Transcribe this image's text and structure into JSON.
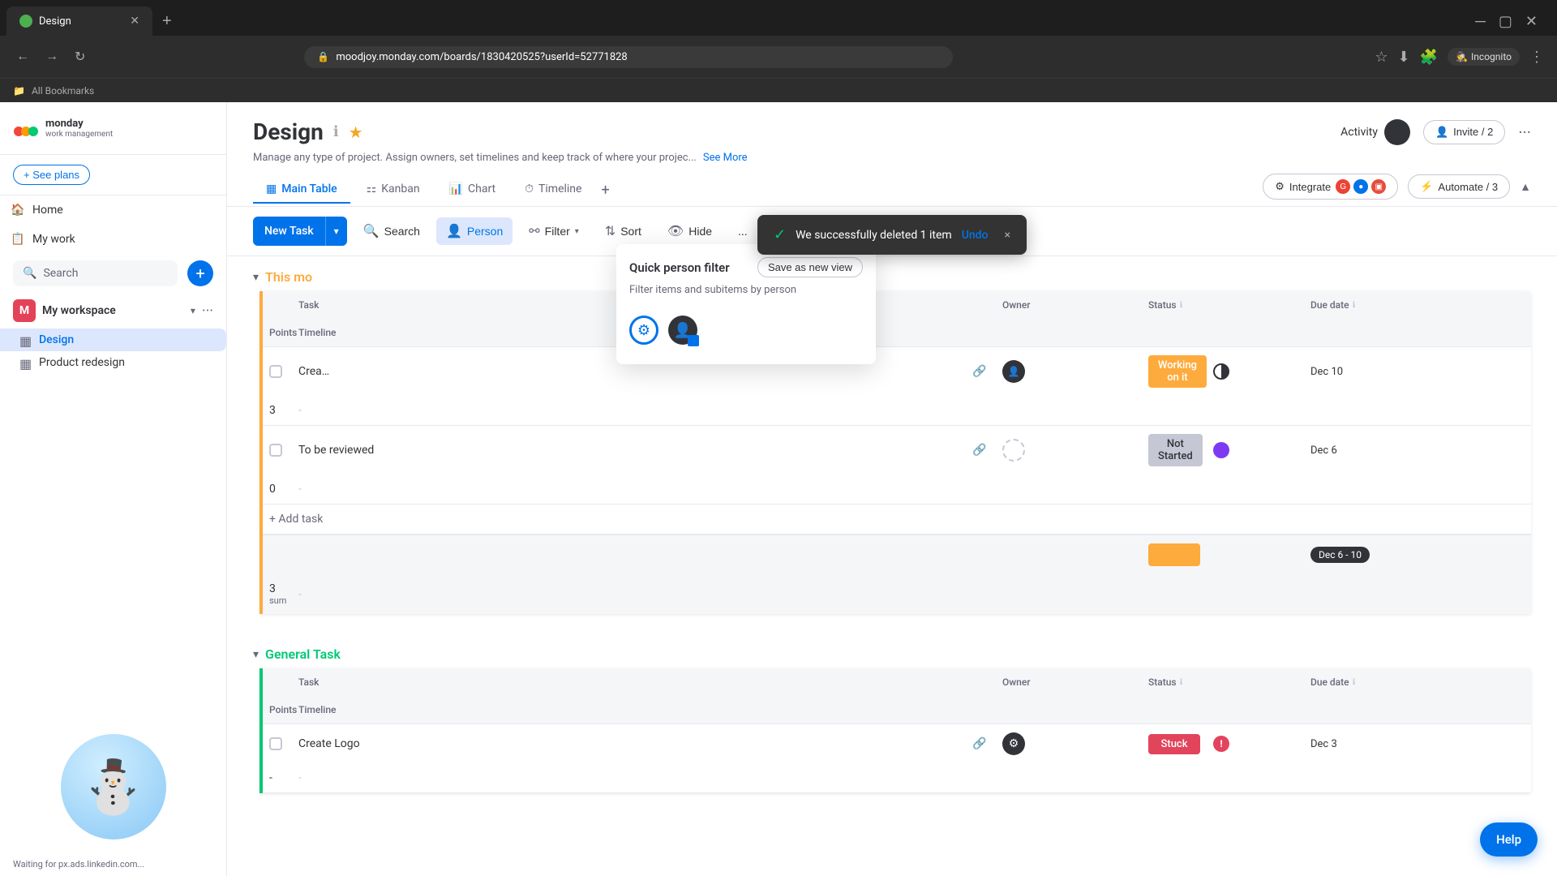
{
  "browser": {
    "tab_title": "Design",
    "url": "moodjoy.monday.com/boards/1830420525?userId=52771828",
    "new_tab_label": "+",
    "bookmarks_label": "All Bookmarks",
    "incognito_label": "Incognito"
  },
  "app": {
    "logo_text": "monday",
    "logo_subtext": "work management",
    "see_plans_label": "+ See plans",
    "notifications_icon": "bell-icon",
    "inbox_icon": "inbox-icon",
    "people_icon": "people-icon",
    "apps_icon": "apps-icon",
    "search_icon": "search-icon",
    "help_icon": "help-icon"
  },
  "sidebar": {
    "home_label": "Home",
    "my_work_label": "My work",
    "search_placeholder": "Search",
    "add_icon": "+",
    "workspace_name": "My workspace",
    "workspace_initial": "M",
    "boards": [
      {
        "label": "Design",
        "active": true
      },
      {
        "label": "Product redesign",
        "active": false
      }
    ]
  },
  "page": {
    "title": "Design",
    "info_icon": "info-icon",
    "star_icon": "star-icon",
    "description": "Manage any type of project. Assign owners, set timelines and keep track of where your projec...",
    "see_more_label": "See More",
    "activity_label": "Activity",
    "invite_label": "Invite / 2",
    "more_icon": "more-icon",
    "tabs": [
      {
        "label": "Main Table",
        "active": true,
        "icon": "table-icon"
      },
      {
        "label": "Kanban",
        "active": false,
        "icon": "kanban-icon"
      },
      {
        "label": "Chart",
        "active": false,
        "icon": "chart-icon"
      },
      {
        "label": "Timeline",
        "active": false,
        "icon": "timeline-icon"
      }
    ],
    "integrate_label": "Integrate",
    "automate_label": "Automate / 3"
  },
  "toolbar": {
    "new_task_label": "New Task",
    "search_label": "Search",
    "person_label": "Person",
    "filter_label": "Filter",
    "sort_label": "Sort",
    "hide_label": "Hide",
    "more_label": "..."
  },
  "toast": {
    "message": "We successfully deleted 1 item",
    "undo_label": "Undo",
    "close_icon": "×"
  },
  "dropdown": {
    "title": "Quick person filter",
    "save_label": "Save as new view",
    "description": "Filter items and subitems by person"
  },
  "groups": [
    {
      "id": "this_month",
      "title": "This mo",
      "color": "orange",
      "columns": [
        "",
        "Task",
        "",
        "Owner",
        "Status",
        "",
        "Due date",
        "",
        "Points",
        "Timeline"
      ],
      "rows": [
        {
          "task": "Crea…",
          "owner_type": "avatar",
          "status": "Working on it",
          "status_class": "status-working",
          "indicator": "ind-half",
          "due_date": "Dec 10",
          "points": "3",
          "timeline": "-"
        },
        {
          "task": "To be reviewed",
          "owner_type": "empty",
          "status": "Not Started",
          "status_class": "status-not-started",
          "indicator": "ind-full",
          "due_date": "Dec 6",
          "points": "0",
          "timeline": "-"
        }
      ],
      "summary": {
        "status_bar": "orange",
        "date_range": "Dec 6 - 10",
        "points": "3",
        "points_label": "sum"
      },
      "add_task_label": "+ Add task"
    },
    {
      "id": "general_task",
      "title": "General Task",
      "color": "green",
      "columns": [
        "",
        "Task",
        "",
        "Owner",
        "Status",
        "",
        "Due date",
        "",
        "Points",
        "Timeline"
      ],
      "rows": [
        {
          "task": "Create Logo",
          "owner_type": "gear",
          "status": "Stuck",
          "status_class": "status-stuck",
          "indicator": "ind-exclaim",
          "due_date": "Dec 3",
          "points": "-",
          "timeline": "-"
        }
      ]
    }
  ],
  "help_label": "Help",
  "status_bar_text": "Waiting for px.ads.linkedin.com...",
  "working_on_label": "Working On"
}
